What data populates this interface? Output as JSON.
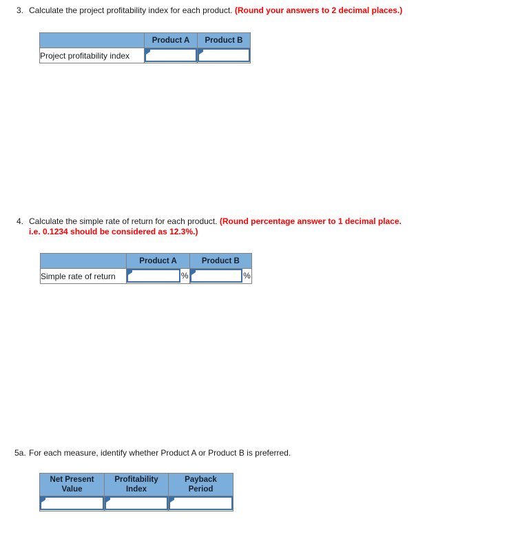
{
  "page": {
    "background_color": "#ffffff",
    "header_fill_color": "#7CAEDC",
    "note_color": "#ff0000",
    "input_border_color": "#3C6FA6",
    "table_border_color": "#808080"
  },
  "questions": [
    {
      "id": "q3",
      "number": "3.",
      "prompt": "Calculate the project profitability index for each product.",
      "note": "(Round your answers to 2 decimal places.)",
      "table": {
        "column_headers": [
          "",
          "Product A",
          "Product B"
        ],
        "rows": [
          {
            "label": "Project profitability index",
            "cells": [
              {
                "value": "",
                "suffix": ""
              },
              {
                "value": "",
                "suffix": ""
              }
            ]
          }
        ]
      }
    },
    {
      "id": "q4",
      "number": "4.",
      "prompt": "Calculate the simple rate of return for each product.",
      "note": "(Round percentage answer to 1 decimal place.",
      "note_line2": "i.e. 0.1234 should be considered as 12.3%.)",
      "table": {
        "column_headers": [
          "",
          "Product A",
          "Product B"
        ],
        "rows": [
          {
            "label": "Simple rate of return",
            "cells": [
              {
                "value": "",
                "suffix": "%"
              },
              {
                "value": "",
                "suffix": "%"
              }
            ]
          }
        ]
      }
    },
    {
      "id": "q5a",
      "number": "5a.",
      "prompt": "For each measure, identify whether Product A or Product B is preferred.",
      "note": "",
      "table": {
        "column_headers": [
          "Net Present Value",
          "Profitability Index",
          "Payback Period"
        ],
        "column_headers_lines": [
          [
            "Net Present",
            "Value"
          ],
          [
            "Profitability",
            "Index"
          ],
          [
            "Payback",
            "Period"
          ]
        ],
        "rows": [
          {
            "label": "",
            "cells": [
              {
                "value": "",
                "suffix": ""
              },
              {
                "value": "",
                "suffix": ""
              },
              {
                "value": "",
                "suffix": ""
              }
            ]
          }
        ]
      }
    }
  ]
}
